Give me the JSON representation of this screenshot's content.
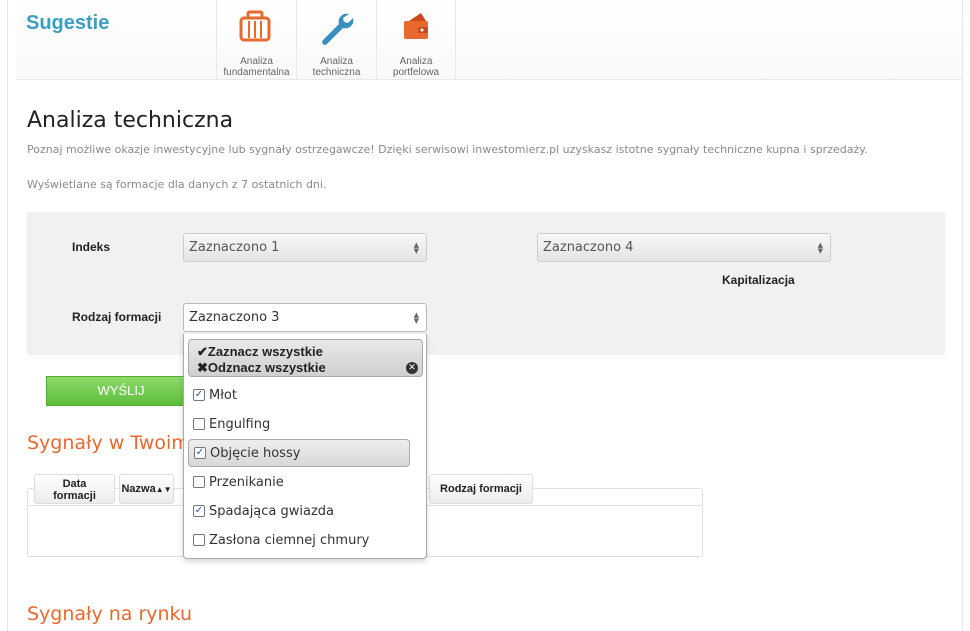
{
  "header": {
    "brand": "Sugestie",
    "tiles": [
      {
        "line1": "Analiza",
        "line2": "fundamentalna",
        "icon": "briefcase-icon"
      },
      {
        "line1": "Analiza",
        "line2": "techniczna",
        "icon": "wrench-icon"
      },
      {
        "line1": "Analiza",
        "line2": "portfelowa",
        "icon": "wallet-icon"
      }
    ]
  },
  "main": {
    "title": "Analiza techniczna",
    "intro": "Poznaj możliwe okazje inwestycyjne lub sygnały ostrzegawcze! Dzięki serwisowi inwestomierz.pl uzyskasz istotne sygnały techniczne kupna i sprzedaży.",
    "note": "Wyświetlane są formacje dla danych z 7 ostatnich dni."
  },
  "filters": {
    "indeks_label": "Indeks",
    "indeks_value": "Zaznaczono 1",
    "kapitalizacja_value": "Zaznaczono 4",
    "kapitalizacja_label": "Kapitalizacja",
    "rodzaj_label": "Rodzaj formacji",
    "rodzaj_value": "Zaznaczono 3",
    "send_label": "WYŚLIJ"
  },
  "dropdown": {
    "select_all": "Zaznacz wszystkie",
    "deselect_all": "Odznacz wszystkie",
    "options": [
      {
        "label": "Młot",
        "checked": true
      },
      {
        "label": "Engulfing",
        "checked": false
      },
      {
        "label": "Objęcie hossy",
        "checked": true
      },
      {
        "label": "Przenikanie",
        "checked": false
      },
      {
        "label": "Spadająca gwiazda",
        "checked": true
      },
      {
        "label": "Zasłona ciemnej chmury",
        "checked": false
      }
    ]
  },
  "signals_yours": {
    "title": "Sygnały w Twoim",
    "columns": {
      "data_line1": "Data",
      "data_line2": "formacji",
      "nazwa": "Nazwa",
      "rodzaj": "Rodzaj formacji"
    }
  },
  "signals_market": {
    "title": "Sygnały na rynku"
  },
  "colors": {
    "brand": "#3a9fc0",
    "section_title": "#e8692e",
    "send_button": "#5cbf3a",
    "icon_orange": "#e8692e",
    "icon_blue": "#3a8fc0"
  }
}
